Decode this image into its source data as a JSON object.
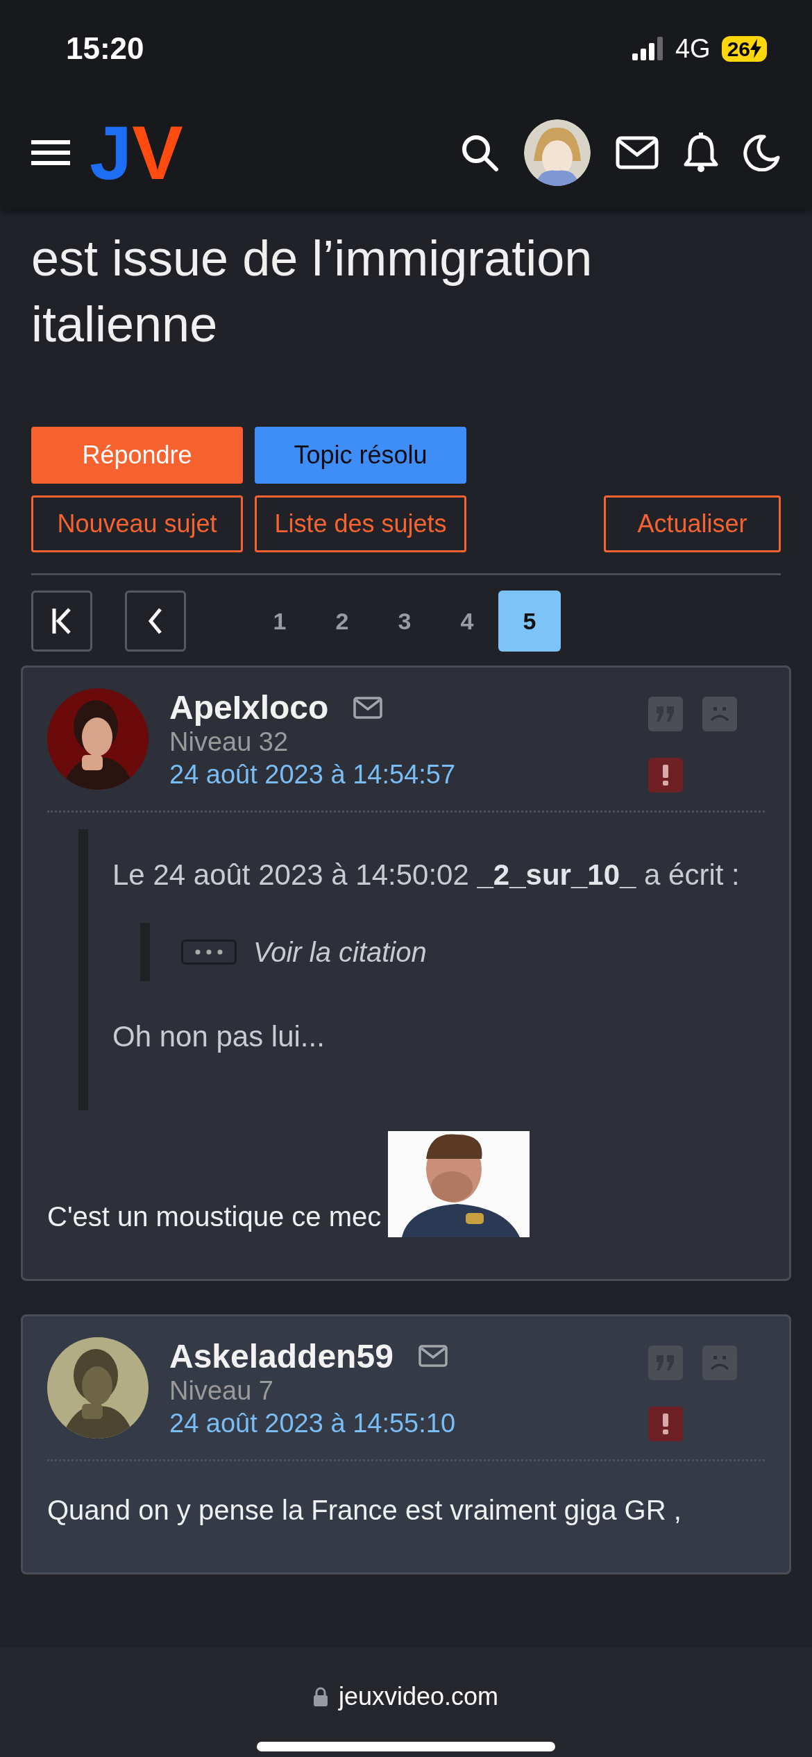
{
  "status_bar": {
    "time": "15:20",
    "network": "4G",
    "battery": "26"
  },
  "navbar": {
    "logo_left": "J",
    "logo_right": "V"
  },
  "topic": {
    "title": "est issue de l’immigration italienne"
  },
  "actions": [
    {
      "label": "Répondre",
      "kind": "solid-orange"
    },
    {
      "label": "Topic résolu",
      "kind": "solid-blue"
    }
  ],
  "tools": [
    {
      "label": "Nouveau sujet"
    },
    {
      "label": "Liste des sujets"
    },
    {
      "label": "Actualiser"
    }
  ],
  "pagination": [
    {
      "label": "1",
      "selected": false
    },
    {
      "label": "2",
      "selected": false
    },
    {
      "label": "3",
      "selected": false
    },
    {
      "label": "4",
      "selected": false
    },
    {
      "label": "5",
      "selected": true
    }
  ],
  "posts": [
    {
      "author": "ApeIxloco",
      "level": "Niveau 32",
      "date": "24 août 2023 à 14:54:57",
      "highlighted": false,
      "quote": {
        "prefix": "Le 24 août 2023 à 14:50:02",
        "author": "_2_sur_10_",
        "suffix": "a écrit :",
        "nested": "Voir la citation",
        "text": "Oh non pas lui..."
      },
      "body": "C'est un moustique ce mec"
    },
    {
      "author": "Askeladden59",
      "level": "Niveau 7",
      "date": "24 août 2023 à 14:55:10",
      "highlighted": true,
      "body": "Quand on y pense la France est vraiment giga GR ,"
    }
  ],
  "address_bar": {
    "url": "jeuxvideo.com"
  }
}
